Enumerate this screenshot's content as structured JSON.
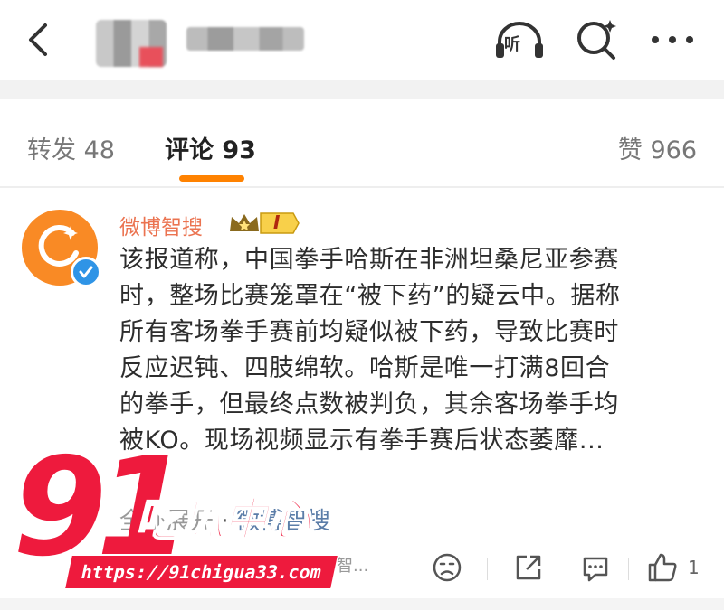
{
  "header": {
    "listen_label": "听"
  },
  "tabs": {
    "repost": "转发 48",
    "comments": "评论 93",
    "likes": "赞 966"
  },
  "comment": {
    "author": "微博智搜",
    "badge_text": "I",
    "lines": [
      "该报道称，中国拳手哈斯在非洲坦桑尼亚参赛",
      "时，整场比赛笼罩在“被下药”的疑云中。据称",
      "所有客场拳手赛前均疑似被下药，导致比赛时",
      "反应迟钝、四肢绵软。哈斯是唯一打满8回合",
      "的拳手，但最终点数被判负，其余客场拳手均",
      "被KO。现场视频显示有拳手赛后状态萎靡..."
    ],
    "source_prefix": "全部展开",
    "source_name": "微博智搜",
    "truncated": "智...",
    "like_count": "1"
  },
  "watermark": {
    "number": "91",
    "text": "吃瓜中心",
    "url": "https://91chigua33.com"
  },
  "colors": {
    "accent": "#ff8200",
    "author": "#eb7350",
    "watermark": "#ee1a3d",
    "verified": "#2f94e6"
  },
  "icons": [
    "back-icon",
    "listen-icon",
    "search-icon",
    "more-icon",
    "emoji-icon",
    "share-icon",
    "reply-icon",
    "like-icon",
    "verified-icon",
    "crown-icon"
  ]
}
